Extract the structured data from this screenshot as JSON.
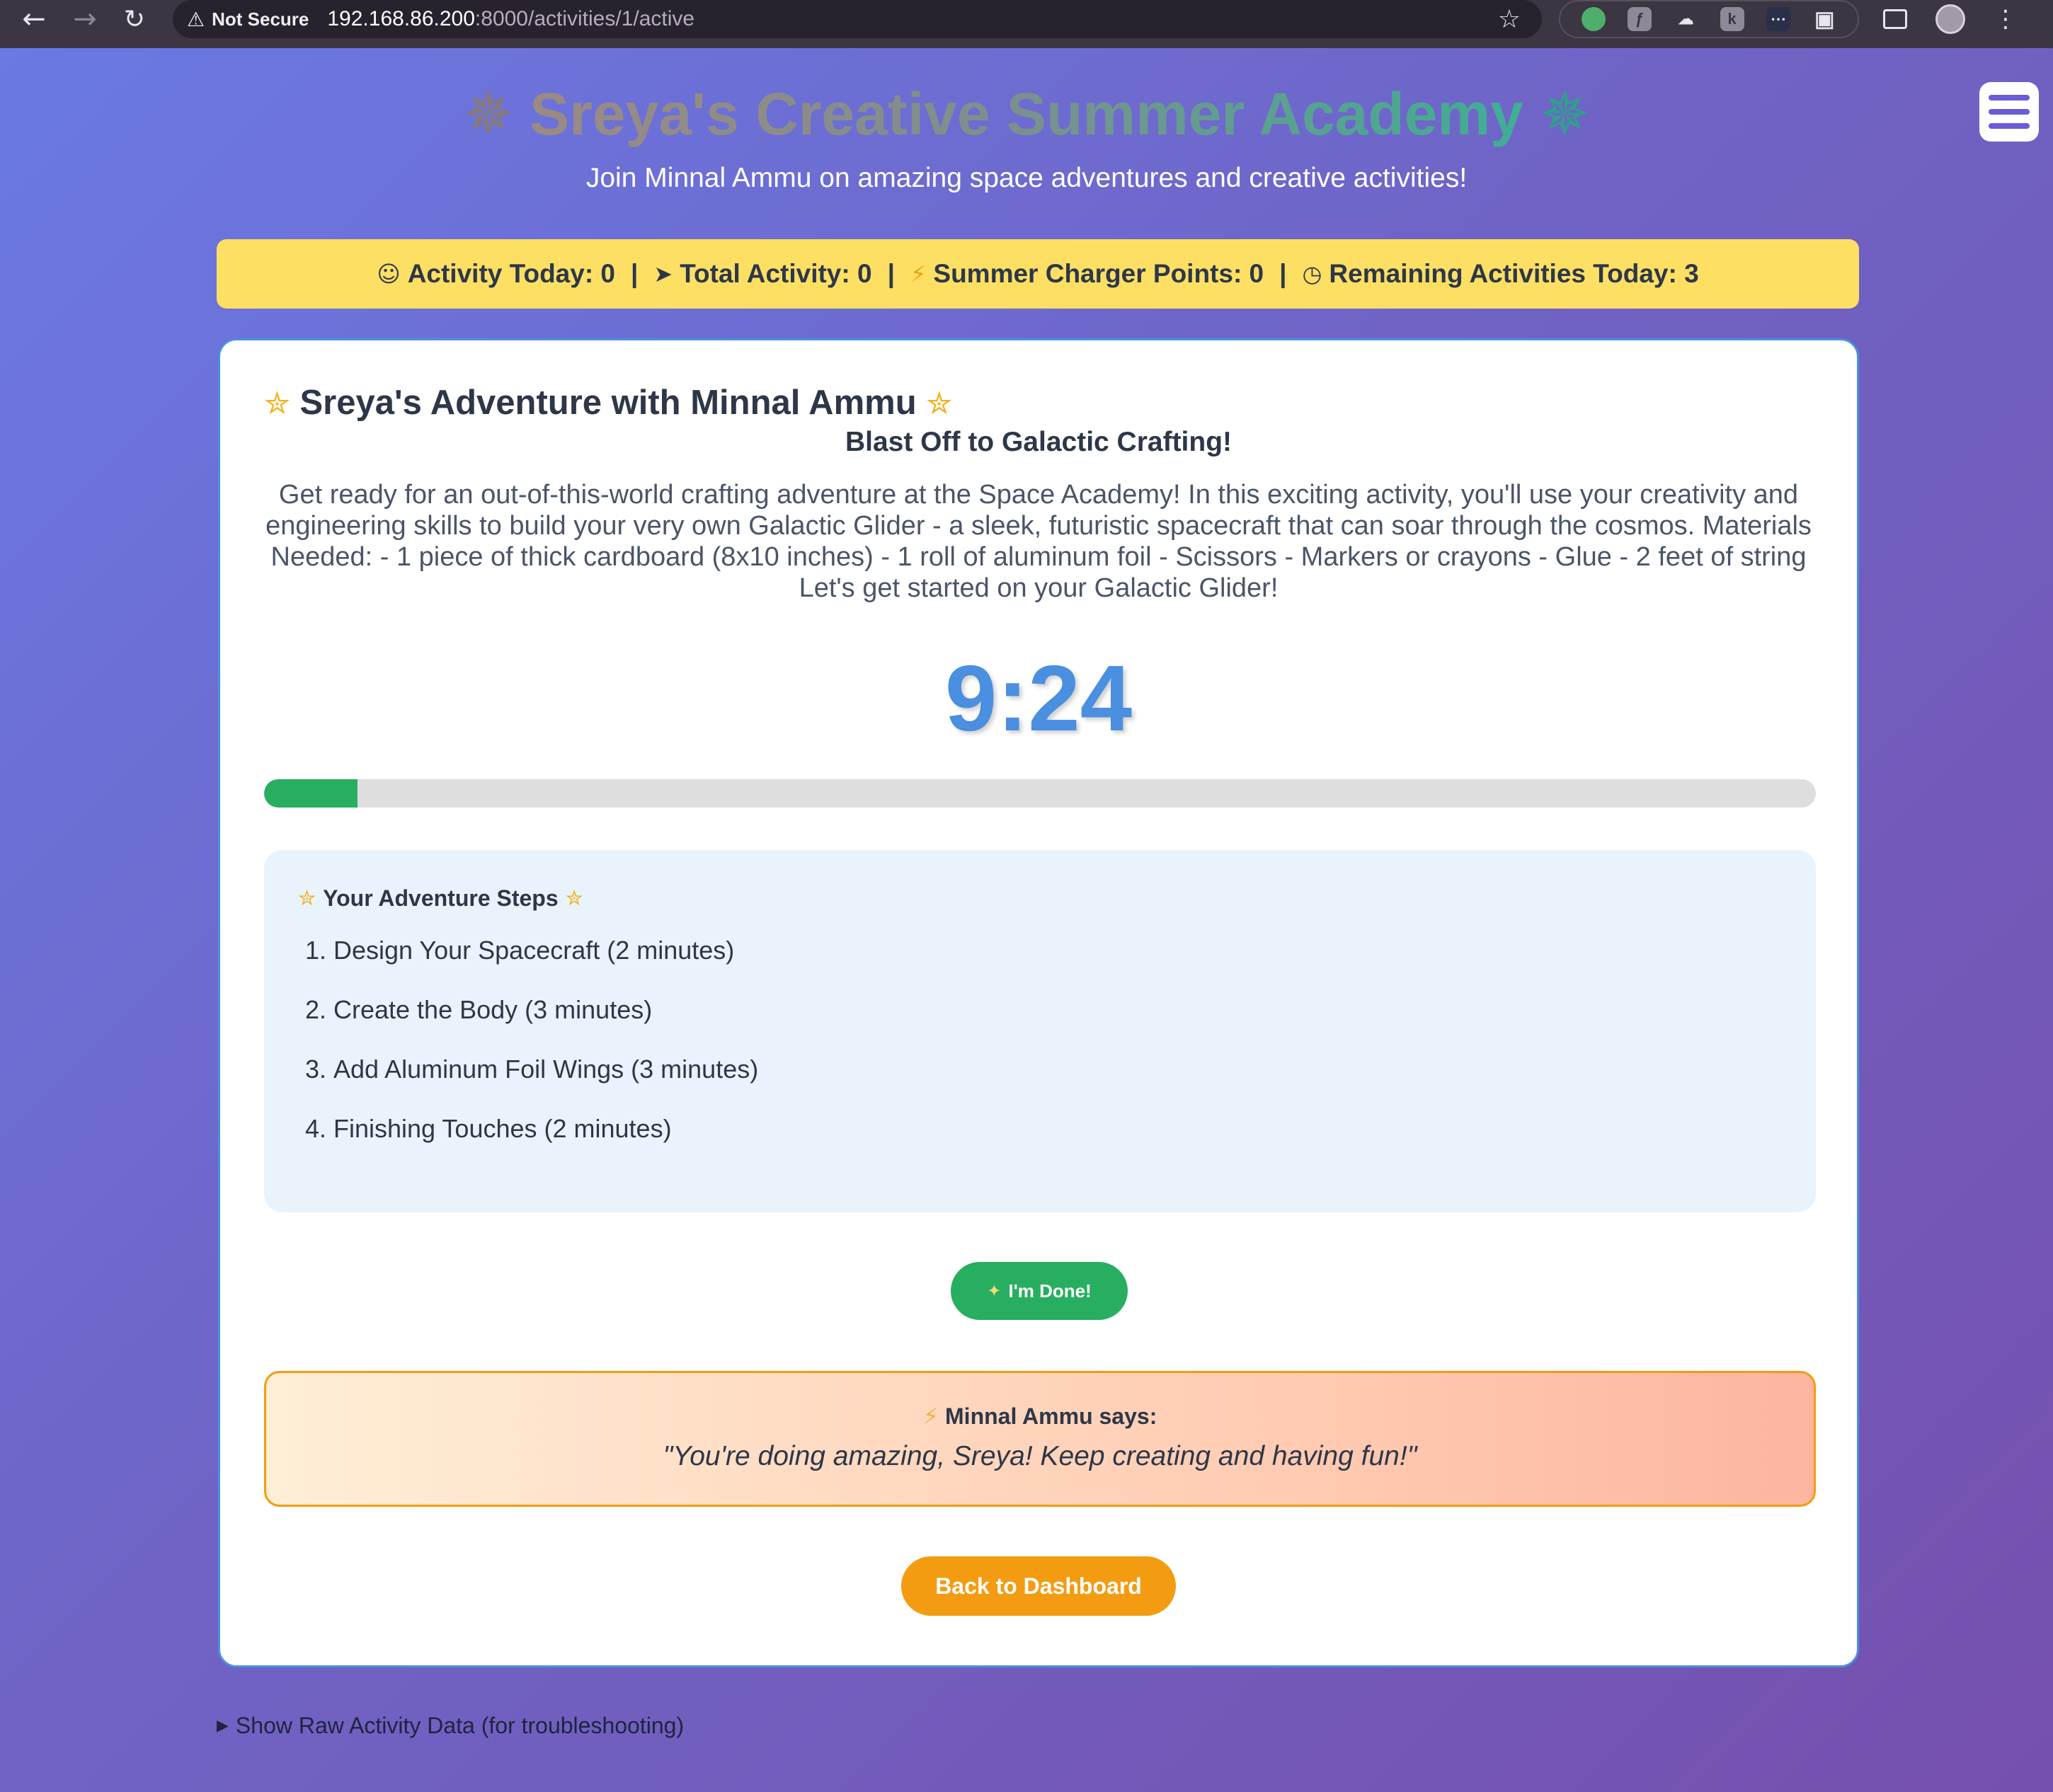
{
  "browser": {
    "not_secure_label": "Not Secure",
    "url_host": "192.168.86.200",
    "url_rest": ":8000/activities/1/active"
  },
  "header": {
    "title": "Sreya's Creative Summer Academy",
    "subtitle": "Join Minnal Ammu on amazing space adventures and creative activities!"
  },
  "stats": {
    "activity_today": "Activity Today: 0",
    "total_activity": "Total Activity: 0",
    "charger_points": "Summer Charger Points: 0",
    "remaining": "Remaining Activities Today: 3",
    "separator": "|"
  },
  "card": {
    "heading": "Sreya's Adventure with Minnal Ammu",
    "activity_title": "Blast Off to Galactic Crafting!",
    "description": "Get ready for an out-of-this-world crafting adventure at the Space Academy! In this exciting activity, you'll use your creativity and engineering skills to build your very own Galactic Glider - a sleek, futuristic spacecraft that can soar through the cosmos. Materials Needed: - 1 piece of thick cardboard (8x10 inches) - 1 roll of aluminum foil - Scissors - Markers or crayons - Glue - 2 feet of string Let's get started on your Galactic Glider!",
    "timer": "9:24",
    "progress_percent": 6
  },
  "steps": {
    "heading": "Your Adventure Steps",
    "items": [
      "Design Your Spacecraft (2 minutes)",
      "Create the Body (3 minutes)",
      "Add Aluminum Foil Wings (3 minutes)",
      "Finishing Touches (2 minutes)"
    ]
  },
  "actions": {
    "done_label": "I'm Done!",
    "back_label": "Back to Dashboard"
  },
  "quote": {
    "speaker": "Minnal Ammu says:",
    "text": "\"You're doing amazing, Sreya! Keep creating and having fun!\""
  },
  "footer": {
    "raw_toggle": "Show Raw Activity Data (for troubleshooting)"
  },
  "icons": {
    "title_left": "star-icon",
    "title_right": "star-icon",
    "activity_today": "smiley-icon",
    "total_activity": "rocket-icon",
    "charger_points": "lightning-icon",
    "remaining": "clock-icon",
    "heading": "glowing-star-icon",
    "done": "party-popper-icon",
    "quote": "lightning-bolt-icon"
  },
  "colors": {
    "accent_blue": "#4a90e2",
    "success_green": "#27ae60",
    "warning_orange": "#f39c12",
    "stats_yellow": "#fddf64"
  }
}
